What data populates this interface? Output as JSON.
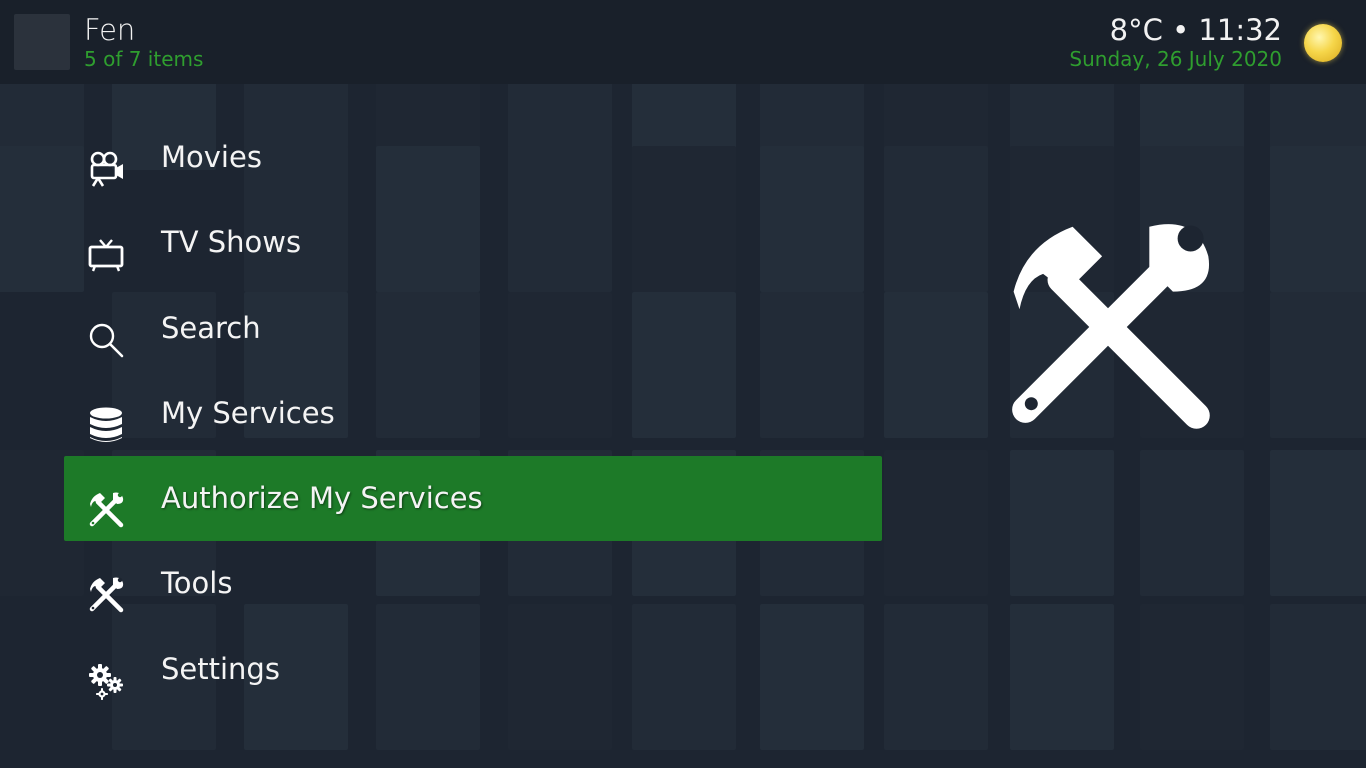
{
  "header": {
    "app_title": "Fen",
    "item_count": "5 of 7 items",
    "weather_time": "8°C • 11:32",
    "date": "Sunday, 26 July 2020",
    "weather_icon": "sun-icon"
  },
  "menu": {
    "selected_index": 4,
    "items": [
      {
        "label": "Movies",
        "icon": "movie-camera-icon"
      },
      {
        "label": "TV Shows",
        "icon": "tv-icon"
      },
      {
        "label": "Search",
        "icon": "search-icon"
      },
      {
        "label": "My Services",
        "icon": "database-icon"
      },
      {
        "label": "Authorize My Services",
        "icon": "tools-icon"
      },
      {
        "label": "Tools",
        "icon": "tools-icon"
      },
      {
        "label": "Settings",
        "icon": "gears-icon"
      }
    ]
  },
  "preview": {
    "icon": "tools-icon"
  },
  "colors": {
    "accent": "#1d7a28",
    "accent_text": "#2f9e2f",
    "background": "#1d2531",
    "header": "#19202a"
  }
}
